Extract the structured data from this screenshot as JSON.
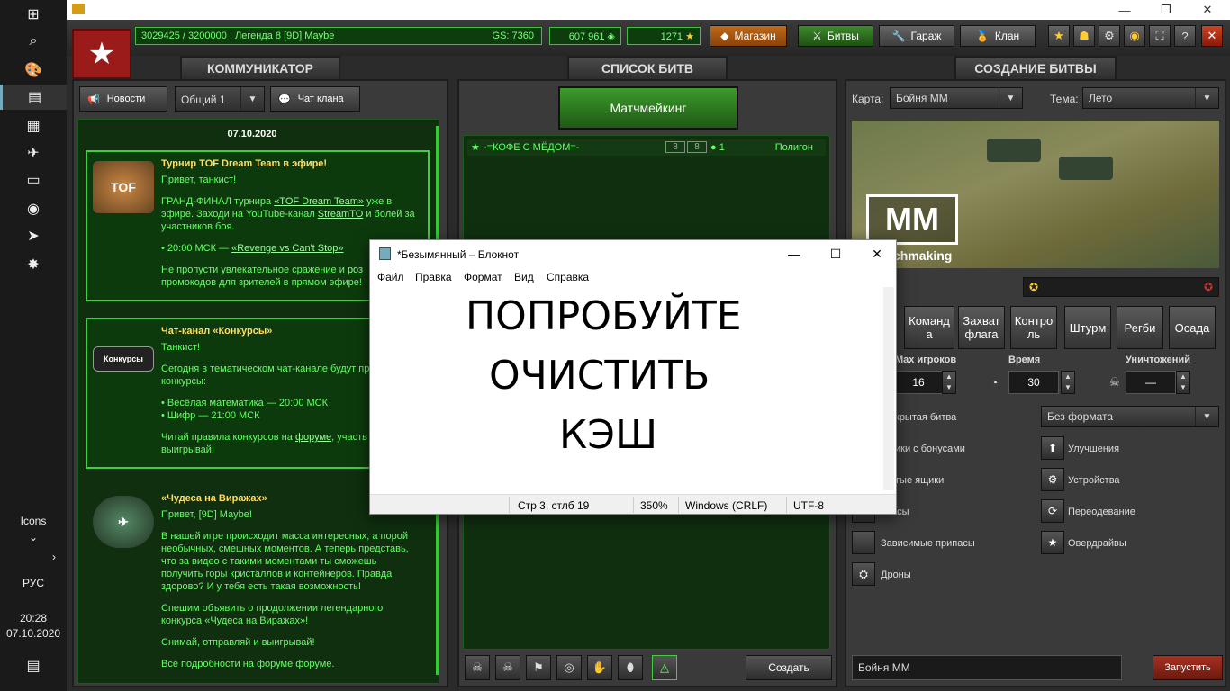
{
  "taskbar": {
    "icons_label": "Icons",
    "lang": "РУС",
    "time": "20:28",
    "date": "07.10.2020"
  },
  "topbar": {
    "xp": "3029425 / 3200000",
    "rank": "Легенда 8 [9D] Maybe",
    "gs": "GS: 7360",
    "crystals": "607 961",
    "stars": "1271",
    "shop": "Магазин",
    "battles": "Битвы",
    "garage": "Гараж",
    "clan": "Клан"
  },
  "communicator": {
    "tab": "КОММУНИКАТОР",
    "news_btn": "Новости",
    "channel_select": "Общий 1",
    "clan_chat_btn": "Чат клана",
    "date": "07.10.2020",
    "news": [
      {
        "thumb": "TOF",
        "title": "Турнир TOF Dream Team в эфире!",
        "greeting": "Привет, танкист!",
        "l1a": "ГРАНД-ФИНАЛ турнира ",
        "l1link": "«TOF Dream Team»",
        "l1b": " уже в",
        "l2a": "эфире. Заходи на YouTube-канал ",
        "l2link": "StreamTO",
        "l2b": " и болей за",
        "l3": "участников боя.",
        "l4a": "• 20:00 МСК — ",
        "l4link": "«Revenge vs Can't Stop»",
        "l5a": "Не пропусти увлекательное сражение и ",
        "l5link": "роз",
        "l6": "промокодов для зрителей в прямом эфире!"
      },
      {
        "thumb": "Конкурсы",
        "title": "Чат-канал «Конкурсы»",
        "greeting": "Танкист!",
        "l1": "Сегодня в тематическом чат-канале будут пр",
        "l2": "конкурсы:",
        "l3": "• Весёлая математика — 20:00 МСК",
        "l4": "• Шифр — 21:00 МСК",
        "l5a": "Читай правила конкурсов на ",
        "l5link": "форуме",
        "l5b": ", участв",
        "l6": "выигрывай!"
      },
      {
        "title": "«Чудеса на Виражах»",
        "greeting": "Привет, [9D] Maybe!",
        "l1": "В нашей игре происходит масса интересных, а порой",
        "l2": "необычных, смешных моментов. А теперь представь,",
        "l3": "что за видео с такими моментами ты сможешь",
        "l4": "получить горы кристаллов и контейнеров. Правда",
        "l5": "здорово? И у тебя есть такая возможность!",
        "l6": "Спешим объявить о продолжении легендарного",
        "l7": "конкурса «Чудеса на Виражах»!",
        "l8": "Снимай, отправляй и выигрывай!",
        "l9": "Все подробности на форуме форуме."
      }
    ]
  },
  "battle_list": {
    "tab": "СПИСОК БИТВ",
    "matchmaking_btn": "Матчмейкинг",
    "rows": [
      {
        "name": "-=КОФЕ С МЁДОМ=-",
        "a": "8",
        "b": "8",
        "players": "1",
        "map": "Полигон"
      }
    ],
    "create_btn": "Создать"
  },
  "battle_create": {
    "tab": "СОЗДАНИЕ БИТВЫ",
    "map_label": "Карта:",
    "map_value": "Бойня ММ",
    "theme_label": "Тема:",
    "theme_value": "Лето",
    "preview_logo": "MM",
    "preview_sub": "chmaking",
    "modes": [
      "Команд\nа",
      "Захват\nфлага",
      "Контро\nль",
      "Штурм",
      "Регби",
      "Осада"
    ],
    "max_players_label": "Max игроков",
    "max_players": "16",
    "time_label": "Время",
    "time": "30",
    "kills_label": "Уничтожений",
    "kills": "—",
    "hidden_battle": "крытая битва",
    "format_value": "Без формата",
    "bonus_boxes": "ики с бонусами",
    "gold_boxes": "тые ящики",
    "supplies": "пасы",
    "dependent_supplies": "Зависимые припасы",
    "drones": "Дроны",
    "upgrades": "Улучшения",
    "devices": "Устройства",
    "reskin": "Переодевание",
    "overdrives": "Овердрайвы",
    "battle_name": "Бойня ММ",
    "launch_btn": "Запустить"
  },
  "notepad": {
    "title": "*Безымянный – Блокнот",
    "menu": [
      "Файл",
      "Правка",
      "Формат",
      "Вид",
      "Справка"
    ],
    "text_lines": [
      "ПОПРОБУЙТЕ",
      "ОЧИСТИТЬ",
      "КЭШ"
    ],
    "status_pos": "Стр 3, стлб 19",
    "status_zoom": "350%",
    "status_eol": "Windows (CRLF)",
    "status_enc": "UTF-8"
  },
  "colors": {
    "accent_green": "#3c9a2c",
    "news_text": "#66ff66",
    "news_title": "#ffdd66",
    "launch_red": "#a83020",
    "shop_orange": "#c06a1a"
  }
}
